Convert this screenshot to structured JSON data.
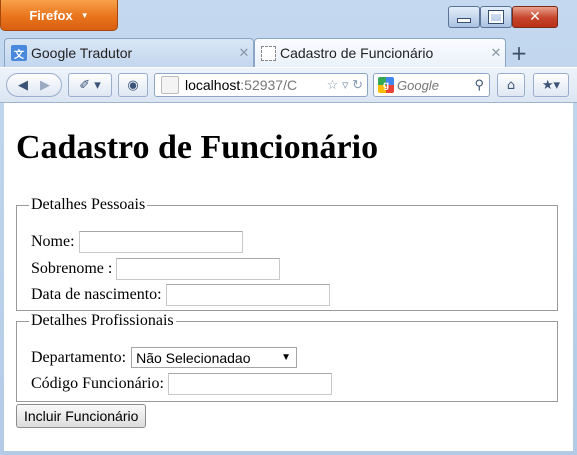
{
  "window": {
    "app_menu_label": "Firefox"
  },
  "tabs": [
    {
      "label": "Google Tradutor",
      "active": false,
      "icon": "google-translate-icon"
    },
    {
      "label": "Cadastro de Funcionário",
      "active": true,
      "icon": "blank-page-icon"
    }
  ],
  "toolbar": {
    "url_host": "localhost",
    "url_rest": ":52937/C",
    "search_placeholder": "Google"
  },
  "page": {
    "title": "Cadastro de Funcionário",
    "personal": {
      "legend": "Detalhes Pessoais",
      "name_label": "Nome:",
      "surname_label": "Sobrenome :",
      "birth_label": "Data de nascimento:"
    },
    "professional": {
      "legend": "Detalhes Profissionais",
      "department_label": "Departamento:",
      "department_value": "Não Selecionadao",
      "code_label": "Código Funcionário:"
    },
    "submit_label": "Incluir Funcionário"
  },
  "colors": {
    "firefox_button": "#e8741c",
    "close_button": "#c6442b"
  }
}
